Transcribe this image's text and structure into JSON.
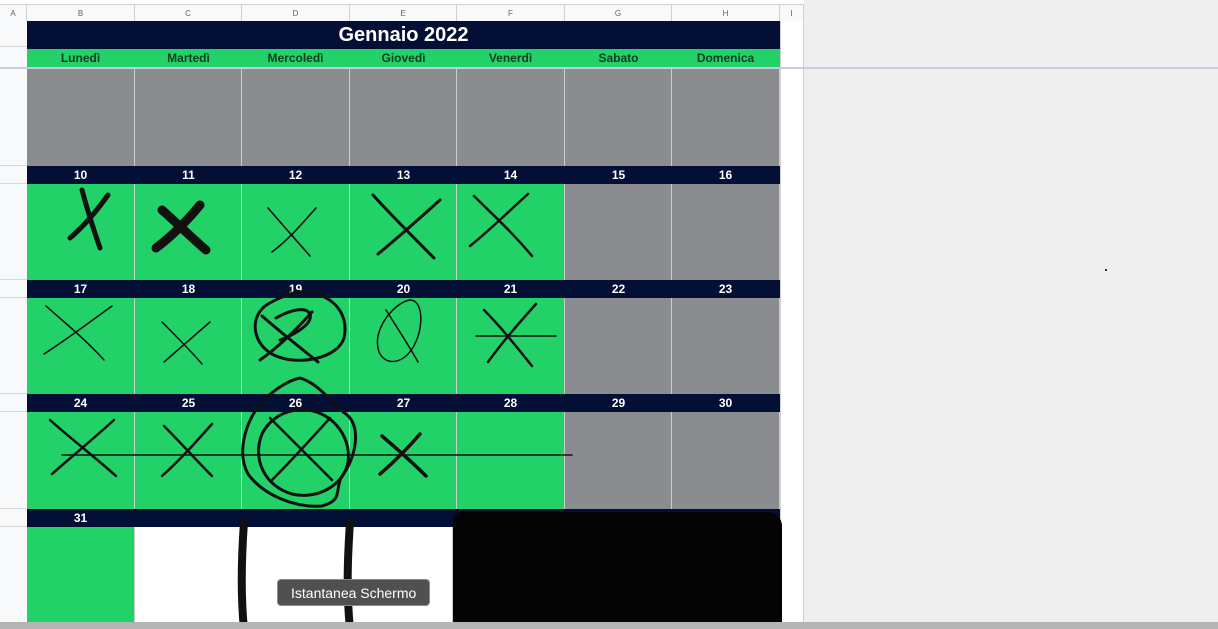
{
  "columns": [
    "A",
    "B",
    "C",
    "D",
    "E",
    "F",
    "G",
    "H",
    "I"
  ],
  "calendar": {
    "title": "Gennaio 2022",
    "weekdays": [
      "Lunedì",
      "Martedì",
      "Mercoledì",
      "Giovedì",
      "Venerdì",
      "Sabato",
      "Domenica"
    ],
    "week2": [
      "10",
      "11",
      "12",
      "13",
      "14",
      "15",
      "16"
    ],
    "week3": [
      "17",
      "18",
      "19",
      "20",
      "21",
      "22",
      "23"
    ],
    "week4": [
      "24",
      "25",
      "26",
      "27",
      "28",
      "29",
      "30"
    ],
    "week5": [
      "31"
    ]
  },
  "tooltip": {
    "text": "Istantanea Schermo"
  },
  "colors": {
    "header_bg": "#040f36",
    "weekday_bg": "#22d268",
    "weekend_bg": "#8a8c90",
    "ink": "#111111"
  }
}
